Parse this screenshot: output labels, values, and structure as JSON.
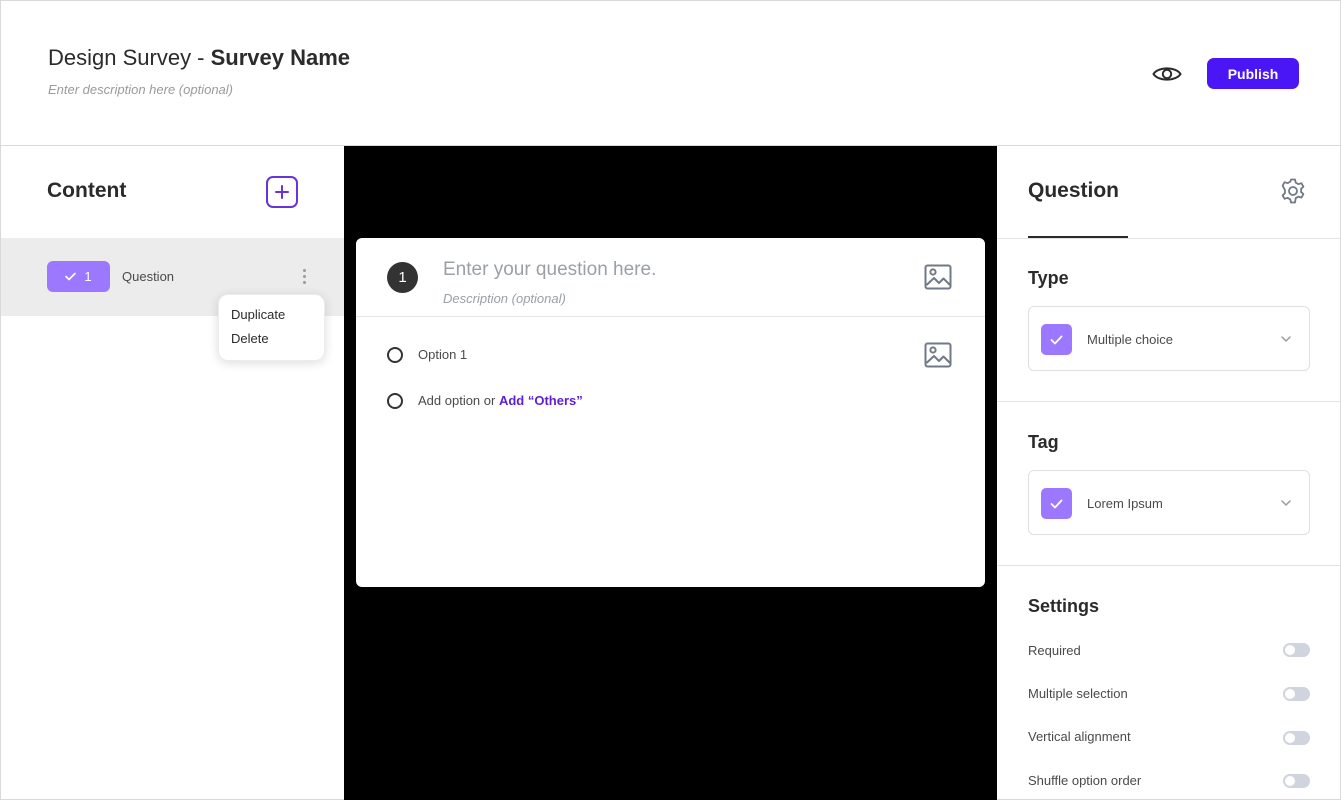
{
  "header": {
    "title_prefix": "Design Survey - ",
    "title_name": "Survey Name",
    "description_placeholder": "Enter description here (optional)",
    "preview_icon": "eye-icon",
    "publish_label": "Publish"
  },
  "content_panel": {
    "title": "Content",
    "add_icon": "plus-icon",
    "items": [
      {
        "number": "1",
        "label": "Question",
        "icon": "check-icon"
      }
    ],
    "context_menu": [
      "Duplicate",
      "Delete"
    ]
  },
  "question_card": {
    "number": "1",
    "question_placeholder": "Enter your question here.",
    "description_placeholder": "Description (optional)",
    "options": [
      "Option 1"
    ],
    "add_option_text": "Add option or ",
    "add_others_text": "Add “Others”",
    "image_icon": "image-icon"
  },
  "question_panel": {
    "title": "Question",
    "settings_icon": "gear-icon",
    "type": {
      "title": "Type",
      "value": "Multiple choice"
    },
    "tag": {
      "title": "Tag",
      "value": "Lorem Ipsum"
    },
    "settings": {
      "title": "Settings",
      "rows": [
        {
          "label": "Required",
          "enabled": false
        },
        {
          "label": "Multiple selection",
          "enabled": false
        },
        {
          "label": "Vertical alignment",
          "enabled": false
        },
        {
          "label": "Shuffle option order",
          "enabled": false
        }
      ]
    }
  },
  "colors": {
    "accent": "#4b16f5",
    "chip": "#9b78ff",
    "link": "#5b1fd6",
    "canvas": "#000000"
  }
}
